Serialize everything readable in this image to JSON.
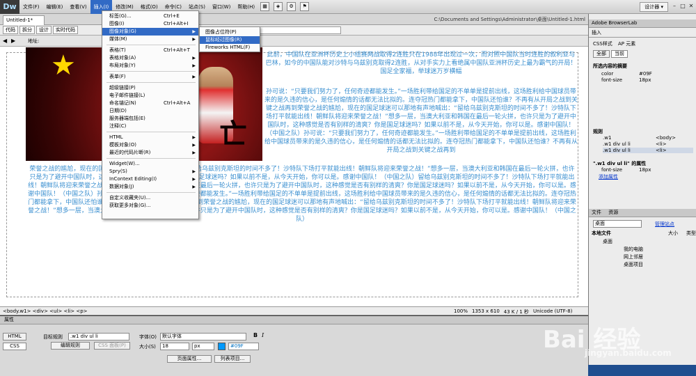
{
  "app": {
    "logo": "Dw",
    "designer": "设计器 ▾"
  },
  "menu": [
    "文件(F)",
    "编辑(E)",
    "查看(V)",
    "插入(I)",
    "修改(M)",
    "格式(O)",
    "命令(C)",
    "站点(S)",
    "窗口(W)",
    "帮助(H)"
  ],
  "document": {
    "tab": "Untitled-1*",
    "path": "C:\\Documents and Settings\\Administrator\\桌面\\Untitled-1.html"
  },
  "view_buttons": [
    "代码",
    "拆分",
    "设计",
    "实时代码"
  ],
  "address_label": "地址:",
  "content": {
    "para1": "此前，中国队在亚洲杯历史上小组赛两战取得2连胜只在1988年出现过一次，而对照中国队当时连胜的叙利亚与巴林，如今的中国队能对沙特与乌兹别克取得2连胜，从对手实力上看绝属中国队亚洲杯历史上最为霸气的开局！国足全家福，举球迷万岁横幅",
    "para2": "孙可说：“只要我们努力了，任何奇迹都能发生。”一场胜利带给国足的不单单是提前出线，这场胜利给中国球员带来的是久违的信心，是任何煽情的话都无法比拟的。连夺冠热门都能拿下，中国队还怕谁？不再有从开局之战到关键之战再到荣誉之战的尴尬，现在的国足球迷可以那地有声地喊出：“留给乌兹别克斯坦的时间不多了！沙特队下场打平就能出线！朝鲜队将迎来荣誉之战！”想多一层，当澳大利亚和韩国在最后一轮火拼，也许只是为了避开中国队时，这种感觉是否有别样的清爽？你是国足球迷吗？如果以前不是，从今天开始，你可以是。感谢中国队！（中国之队）孙可说：“只要我们努力了，任何奇迹都能发生。”一场胜利带给国足的不单单是提前出线，这场胜利给中国球员带来的是久违的信心，是任何煽情的话都无法比拟的。连夺冠热门都能拿下，中国队还怕谁？不再有从开局之战到关键之战再到",
    "para3": "荣誉之战的尴尬，现在的国足球迷可以那地有声地喊出：“留给乌兹别克斯坦的时间不多了！沙特队下场打平就能出线！朝鲜队将迎来荣誉之战！”想多一层，当澳大利亚和韩国在最后一轮火拼，也许只是为了避开中国队时，这种感觉是否有别样的清爽？你是国足球迷吗？如果以前不是，从今天开始，你可以是。感谢中国队！（中国之队）留给乌兹别克斯坦的时间不多了！沙特队下场打平就能出线！朝鲜队将迎来荣誉之战！”想多一层，当澳大利亚和韩国在最后一轮火拼，也许只是为了避开中国队时，这种感觉是否有别样的清爽？你是国足球迷吗？如果以前不是，从今天开始，你可以是。感谢中国队！（中国之队）孙可说：“只要我们努力了，任何奇迹都能发生。”一场胜利带给国足的不单单是提前出线，这场胜利给中国球员带来的是久违的信心，是任何煽情的话都无法比拟的。连夺冠热门都能拿下，中国队还怕谁？不再有从开局之战到关键之战再到荣誉之战的尴尬，现在的国足球迷可以那地有声地喊出：“留给乌兹别克斯坦的时间不多了！沙特队下场打平就能出线！朝鲜队将迎来荣誉之战！”想多一层，当澳大利亚和韩国在最后一轮火拼，也许只是为了避开中国队时，这种感觉是否有别样的清爽？你是国足球迷吗？如果以前不是，从今天开始，你可以是。感谢中国队！（中国之队）",
    "calligraphy": "亡"
  },
  "status": {
    "tags": "<body.w1> <div> <ul> <li> <p>",
    "zoom": "100%",
    "size": "1353 x 610",
    "weight": "43 K / 1 秒",
    "encoding": "Unicode (UTF-8)"
  },
  "properties": {
    "title": "属性",
    "html_btn": "HTML",
    "css_btn": "CSS",
    "target_rule_label": "目标规则",
    "target_rule": ".w1 div ul li",
    "edit_rule": "编辑规则",
    "css_panel": "CSS 面板(P)",
    "font_label": "字体(O)",
    "font_value": "默认字体",
    "size_label": "大小(S)",
    "size_value": "18",
    "unit": "px",
    "color": "#09F",
    "page_props": "页面属性...",
    "list_item": "列表项目..."
  },
  "panel": {
    "browserlab": "Adobe BrowserLab",
    "insert": "插入",
    "css_tabs": [
      "CSS样式",
      "AP 元素"
    ],
    "all_tab": "全部",
    "current_tab": "当前",
    "summary_title": "所选内容的摘要",
    "summary": [
      [
        "color",
        "#09F"
      ],
      [
        "font-size",
        "18px"
      ]
    ],
    "rules_title": "规则",
    "rules": [
      [
        ".w1",
        "<body>"
      ],
      [
        ".w1 div ul li",
        "<li>"
      ],
      [
        ".w1 div ul li",
        "<li>"
      ]
    ],
    "props_title": "\".w1 div ul li\" 的属性",
    "props": [
      [
        "font-size",
        "18px"
      ]
    ],
    "add_prop": "添加属性",
    "files_tabs": [
      "文件",
      "资源"
    ],
    "site_select": "桌面",
    "manage_site": "管理站点",
    "local_files": "本地文件",
    "size_col": "大小",
    "type_col": "类型",
    "tree": [
      "桌面",
      "我的电脑",
      "网上邻居",
      "桌面项目"
    ]
  },
  "insert_menu": [
    {
      "label": "标签(G)...",
      "shortcut": "Ctrl+E"
    },
    {
      "label": "图像(I)",
      "shortcut": "Ctrl+Alt+I"
    },
    {
      "label": "图像对象(G)",
      "arrow": true,
      "highlight": true
    },
    {
      "label": "媒体(M)",
      "arrow": true
    },
    {
      "sep": true
    },
    {
      "label": "表格(T)",
      "shortcut": "Ctrl+Alt+T"
    },
    {
      "label": "表格对象(A)",
      "arrow": true
    },
    {
      "label": "布局对象(Y)",
      "arrow": true
    },
    {
      "sep": true
    },
    {
      "label": "表单(F)",
      "arrow": true
    },
    {
      "sep": true
    },
    {
      "label": "超级链接(P)"
    },
    {
      "label": "电子邮件链接(L)"
    },
    {
      "label": "命名锚记(N)",
      "shortcut": "Ctrl+Alt+A"
    },
    {
      "label": "日期(D)"
    },
    {
      "label": "服务器端包括(E)"
    },
    {
      "label": "注释(C)"
    },
    {
      "sep": true
    },
    {
      "label": "HTML",
      "arrow": true
    },
    {
      "label": "模板对象(O)",
      "arrow": true
    },
    {
      "label": "最近的代码片断(R)",
      "arrow": true
    },
    {
      "sep": true
    },
    {
      "label": "Widget(W)..."
    },
    {
      "label": "Spry(S)",
      "arrow": true
    },
    {
      "label": "InContext Editing(I)",
      "arrow": true
    },
    {
      "label": "数据对象(J)",
      "arrow": true
    },
    {
      "sep": true
    },
    {
      "label": "自定义收藏夹(U)..."
    },
    {
      "label": "获取更多对象(G)..."
    }
  ],
  "submenu": [
    {
      "label": "图像占位符(P)"
    },
    {
      "label": "鼠标经过图像(R)",
      "highlight": true
    },
    {
      "label": "Fireworks HTML(F)"
    }
  ],
  "watermark": {
    "big": "Bai 经验",
    "small": "jingyan.baidu.com"
  }
}
